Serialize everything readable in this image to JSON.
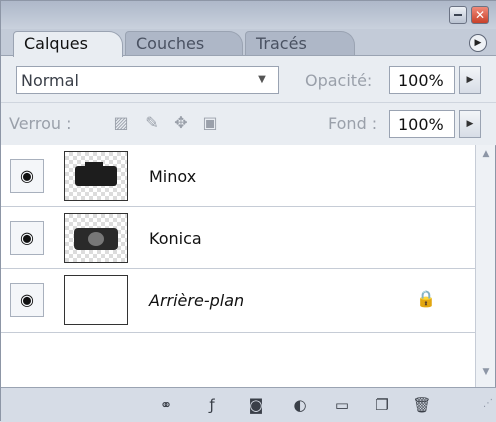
{
  "tabs": [
    {
      "label": "Calques",
      "active": true
    },
    {
      "label": "Couches",
      "active": false
    },
    {
      "label": "Tracés",
      "active": false
    }
  ],
  "blend": {
    "mode": "Normal",
    "opacity_label": "Opacité:",
    "opacity_value": "100%"
  },
  "lock_row": {
    "label": "Verrou :",
    "fill_label": "Fond :",
    "fill_value": "100%"
  },
  "layers": [
    {
      "name": "Minox",
      "visible": true,
      "italic": false
    },
    {
      "name": "Konica",
      "visible": true,
      "italic": false
    },
    {
      "name": "Arrière-plan",
      "visible": true,
      "italic": true,
      "locked": true
    }
  ],
  "icons": {
    "eye": "eye-icon",
    "lock": "lock-icon",
    "link": "link-layers-icon",
    "fx": "layer-style-icon",
    "mask": "add-mask-icon",
    "adjust": "adjustment-layer-icon",
    "group": "new-group-icon",
    "new": "new-layer-icon",
    "trash": "trash-icon"
  },
  "colors": {
    "panel_bg": "#d6dce6",
    "active_tab": "#e9edf2",
    "close_btn": "#c8412a"
  }
}
